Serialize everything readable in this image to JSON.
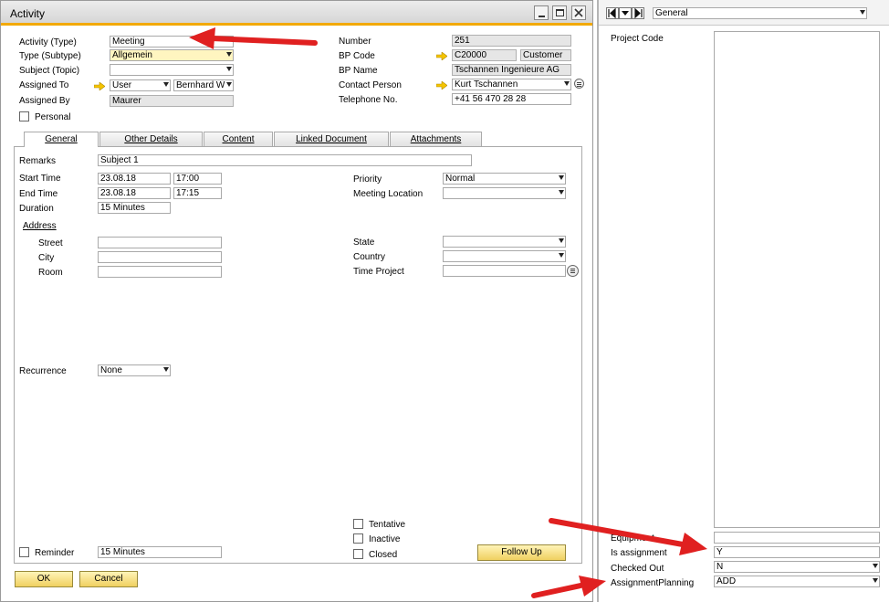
{
  "window": {
    "title": "Activity"
  },
  "left": {
    "activity_type_label": "Activity (Type)",
    "activity_type_value": "Meeting",
    "type_subtype_label": "Type (Subtype)",
    "type_subtype_value": "Allgemein",
    "subject_label": "Subject (Topic)",
    "subject_value": "",
    "assigned_to_label": "Assigned To",
    "assigned_to_kind": "User",
    "assigned_to_value": "Bernhard W",
    "assigned_by_label": "Assigned By",
    "assigned_by_value": "Maurer",
    "personal_label": "Personal"
  },
  "right": {
    "number_label": "Number",
    "number_value": "251",
    "bp_code_label": "BP Code",
    "bp_code_value": "C20000",
    "bp_type_value": "Customer",
    "bp_name_label": "BP Name",
    "bp_name_value": "Tschannen Ingenieure AG",
    "contact_label": "Contact Person",
    "contact_value": "Kurt Tschannen",
    "phone_label": "Telephone No.",
    "phone_value": "+41 56 470 28 28"
  },
  "tabs": [
    "General",
    "Other Details",
    "Content",
    "Linked Document",
    "Attachments"
  ],
  "general": {
    "remarks_label": "Remarks",
    "remarks_value": "Subject 1",
    "start_label": "Start Time",
    "start_date": "23.08.18",
    "start_time": "17:00",
    "end_label": "End Time",
    "end_date": "23.08.18",
    "end_time": "17:15",
    "duration_label": "Duration",
    "duration_value": "15 Minutes",
    "address_label": "Address",
    "street_label": "Street",
    "city_label": "City",
    "room_label": "Room",
    "priority_label": "Priority",
    "priority_value": "Normal",
    "meeting_location_label": "Meeting Location",
    "state_label": "State",
    "country_label": "Country",
    "time_project_label": "Time Project",
    "recurrence_label": "Recurrence",
    "recurrence_value": "None",
    "tentative_label": "Tentative",
    "inactive_label": "Inactive",
    "closed_label": "Closed",
    "reminder_label": "Reminder",
    "reminder_value": "15 Minutes",
    "follow_up_label": "Follow Up"
  },
  "footer": {
    "ok_label": "OK",
    "cancel_label": "Cancel"
  },
  "udf": {
    "category_value": "General",
    "project_code_label": "Project Code",
    "equipment_label": "Equipment",
    "is_assignment_label": "Is assignment",
    "is_assignment_value": "Y",
    "checked_out_label": "Checked Out",
    "checked_out_value": "N",
    "assignment_planning_label": "AssignmentPlanning",
    "assignment_planning_value": "ADD"
  },
  "colors": {
    "title_bar": "#dcdcdc",
    "accent_line": "#f2a900",
    "button_yellow": "#f0d060",
    "arrow_red": "#e02020"
  }
}
